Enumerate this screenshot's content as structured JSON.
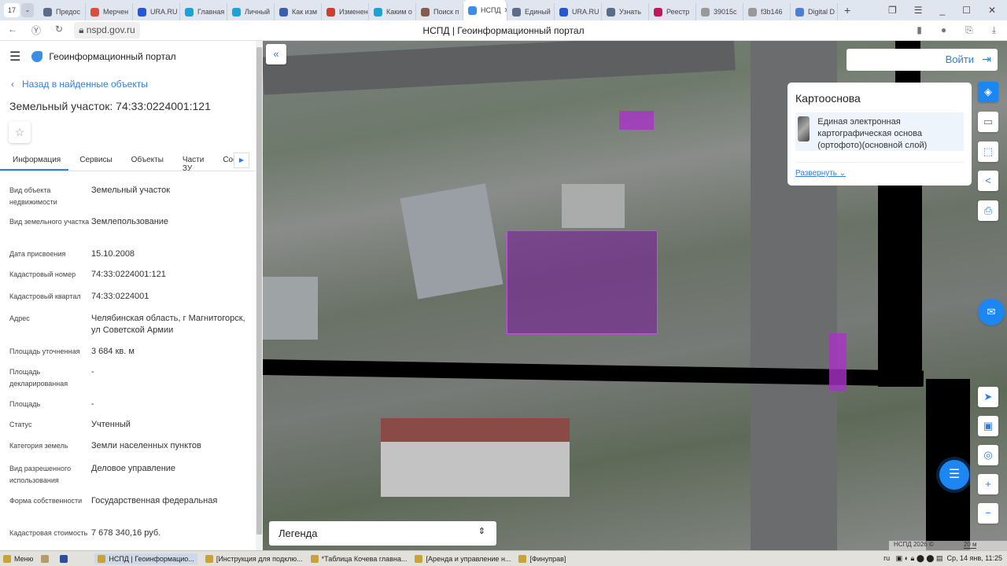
{
  "browser": {
    "tab_count": "17",
    "tabs": [
      {
        "label": "Предос",
        "color": "#5b6b8a"
      },
      {
        "label": "Мерчен",
        "color": "#e24a3b"
      },
      {
        "label": "URA.RU",
        "color": "#2557d6"
      },
      {
        "label": "Главная",
        "color": "#1aa3d9"
      },
      {
        "label": "Личный",
        "color": "#1aa3d9"
      },
      {
        "label": "Как изм",
        "color": "#3b5fb0"
      },
      {
        "label": "Изменен",
        "color": "#d23b2e"
      },
      {
        "label": "Каким о",
        "color": "#1aa3d9"
      },
      {
        "label": "Поиск п",
        "color": "#8a5a4a"
      },
      {
        "label": "НСПД",
        "color": "#3a8ee6",
        "active": true
      },
      {
        "label": "Единый",
        "color": "#5b6b8a"
      },
      {
        "label": "URA.RU",
        "color": "#2557d6"
      },
      {
        "label": "Узнать",
        "color": "#5b6b8a"
      },
      {
        "label": "Реестр",
        "color": "#c2185b"
      },
      {
        "label": "39015c",
        "color": "#999"
      },
      {
        "label": "f3b146",
        "color": "#999"
      },
      {
        "label": "Digital D",
        "color": "#4a7fd6"
      }
    ],
    "url": "nspd.gov.ru",
    "page_title": "НСПД | Геоинформационный портал"
  },
  "panel": {
    "portal_name": "Геоинформационный портал",
    "back_link": "Назад в найденные объекты",
    "title": "Земельный участок: 74:33:0224001:121",
    "tabs": [
      "Информация",
      "Сервисы",
      "Объекты",
      "Части ЗУ",
      "Состав"
    ],
    "properties": [
      {
        "key": "Вид объекта недвижимости",
        "value": "Земельный участок"
      },
      {
        "key": "Вид земельного участка",
        "value": "Землепользование"
      },
      {
        "key": "Дата присвоения",
        "value": "15.10.2008"
      },
      {
        "key": "Кадастровый номер",
        "value": "74:33:0224001:121"
      },
      {
        "key": "Кадастровый квартал",
        "value": "74:33:0224001"
      },
      {
        "key": "Адрес",
        "value": "Челябинская область, г Магнитогорск, ул Советской Армии"
      },
      {
        "key": "Площадь уточненная",
        "value": "3 684 кв. м"
      },
      {
        "key": "Площадь декларированная",
        "value": "-"
      },
      {
        "key": "Площадь",
        "value": "-"
      },
      {
        "key": "Статус",
        "value": "Учтенный"
      },
      {
        "key": "Категория земель",
        "value": "Земли населенных пунктов"
      },
      {
        "key": "Вид разрешенного использования",
        "value": "Деловое управление"
      },
      {
        "key": "Форма собственности",
        "value": "Государственная федеральная"
      },
      {
        "key": "Кадастровая стоимость",
        "value": "7 678 340,16 руб."
      }
    ]
  },
  "map": {
    "login": "Войти",
    "basemap_card": {
      "title": "Картооснова",
      "layer": "Единая электронная картографическая основа (ортофото)(основной слой)",
      "expand": "Развернуть"
    },
    "legend": "Легенда",
    "copyright": "НСПД 2026 ©",
    "scale": "20 м",
    "parcel_color": "#9b2fb8"
  },
  "taskbar": {
    "menu": "Меню",
    "items": [
      "НСПД | Геоинформацио...",
      "[Инструкция для подклю...",
      "*Таблица Кочева главна...",
      "[Аренда и управление н...",
      "[Финуправ]"
    ],
    "lang": "ru",
    "clock": "Ср, 14 янв, 11:25"
  }
}
